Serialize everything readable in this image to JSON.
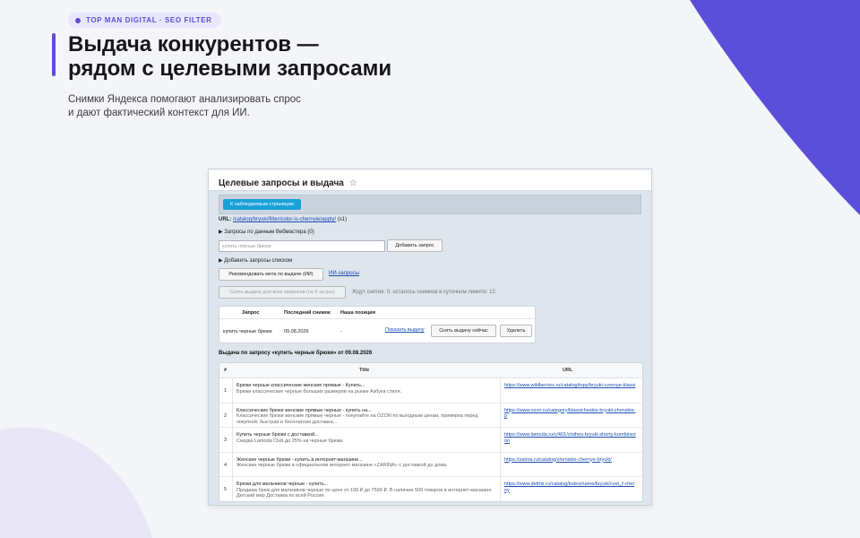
{
  "badge": {
    "text": "TOP MAN DIGITAL · SEO FILTER"
  },
  "headline": {
    "line1": "Выдача конкурентов —",
    "line2": "рядом с целевыми запросами"
  },
  "subtitle": {
    "line1": "Снимки Яндекса помогают анализировать спрос",
    "line2": "и дают фактический контекст для ИИ."
  },
  "colors": {
    "accent": "#5b4fd9",
    "link": "#1a4fb4",
    "button_blue": "#19a0d8"
  },
  "panel": {
    "title": "Целевые запросы и выдача",
    "back_button": "К наблюдаемым страницам",
    "url_label": "URL:",
    "url_value": "/catalog/bryuki/filter/color-is-chernyie/apply/",
    "url_suffix": "(s1)",
    "webmaster_toggle": "▶ Запросы по данным Вебмастера (0)",
    "query_input_placeholder": "купить чёрные брюки",
    "add_query_button": "Добавить запрос",
    "add_list_toggle": "▶ Добавить запросы списком",
    "recommend_button": "Рекомендовать мета по выдаче (ИИ)",
    "ai_queries_link": "ИИ-запросы",
    "snapshot_all_button": "Снять выдачу для всех запросов (по 5 за раз)",
    "snapshot_status": "Ждут снятия: 0; осталось снимков в суточном лимите: 12.",
    "queries_table": {
      "headers": [
        "Запрос",
        "Последний снимок",
        "Наша позиция"
      ],
      "rows": [
        {
          "query": "купить черные брюки",
          "last_snapshot": "09.08.2026",
          "position": "-",
          "show_link": "Показать выдачу",
          "snapshot_button": "Снять выдачу сейчас",
          "delete_button": "Удалить"
        }
      ]
    },
    "results_title": "Выдача по запросу «купить черные брюки» от 09.08.2026",
    "results_table": {
      "headers": [
        "#",
        "Title",
        "URL"
      ],
      "rows": [
        {
          "n": "1",
          "title": "Брюки черные классические женские прямые - Купить...",
          "snippet": "Брюки классические черные больших размеров на рынке Азбука стиля.",
          "url": "https://www.wildberries.ru/catalog/topy/bryuki-czernye-klassi"
        },
        {
          "n": "2",
          "title": "Классические брюки женские прямые черные - купить на...",
          "snippet": "Классические брюки женские прямые черные - покупайте на OZON по выгодным ценам, примерка перед покупкой, быстрая и бесплатная доставка...",
          "url": "https://www.ozon.ru/category/klassicheskie-bryuki-zhenskie-p"
        },
        {
          "n": "3",
          "title": "Купить черные брюки с доставкой...",
          "snippet": "Скидка Lamoda Club до 25% на черные брюки.",
          "url": "https://www.lamoda.ru/c/401/clothes-bryuki-shorty-kombinezon"
        },
        {
          "n": "4",
          "title": "Женские черные брюки - купить в интернет-магазине...",
          "snippet": "Женские черные брюки в официальном интернет-магазине «ZARINA» с доставкой до дома.",
          "url": "https://zarina.ru/catalog/zhenskie-chernye-bryuki/"
        },
        {
          "n": "5",
          "title": "Брюки для мальчиков черные - купить...",
          "snippet": "Продажа брюк для мальчиков черные по цене от 199 ₽ до 7599 ₽. В наличии 509 товаров в интернет-магазине Детский мир Доставка по всей России.",
          "url": "https://www.detmir.ru/catalog/index/name/bryuki/cvet_f-cherny"
        }
      ]
    }
  }
}
